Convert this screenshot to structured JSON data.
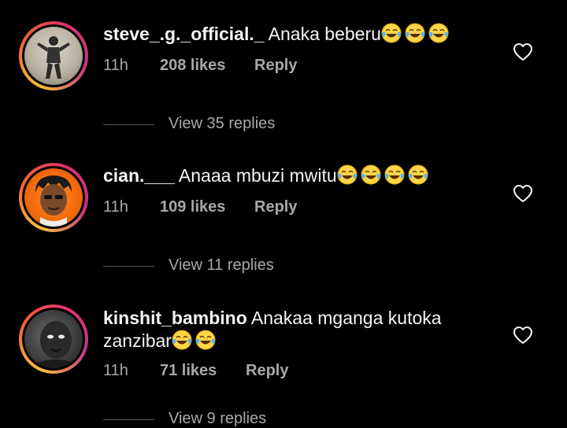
{
  "comments": [
    {
      "username": "steve_.g._official._",
      "text": "Anaka beberu",
      "emoji_count": 3,
      "time": "11h",
      "likes": "208 likes",
      "reply_label": "Reply",
      "view_replies": "View 35 replies"
    },
    {
      "username": "cian.___",
      "text": "Anaaa mbuzi mwitu",
      "emoji_count": 4,
      "time": "11h",
      "likes": "109 likes",
      "reply_label": "Reply",
      "view_replies": "View 11 replies"
    },
    {
      "username": "kinshit_bambino",
      "text": "Anakaa mganga kutoka",
      "text_line2": "zanzibar",
      "emoji_count": 2,
      "time": "11h",
      "likes": "71 likes",
      "reply_label": "Reply",
      "view_replies": "View 9 replies"
    }
  ],
  "icons": {
    "heart": "heart-outline-icon",
    "emoji": "face-with-tears-of-joy"
  },
  "colors": {
    "background": "#000000",
    "primary_text": "#f5f5f5",
    "secondary_text": "#a8a8a8",
    "story_ring": "#e1306c"
  }
}
